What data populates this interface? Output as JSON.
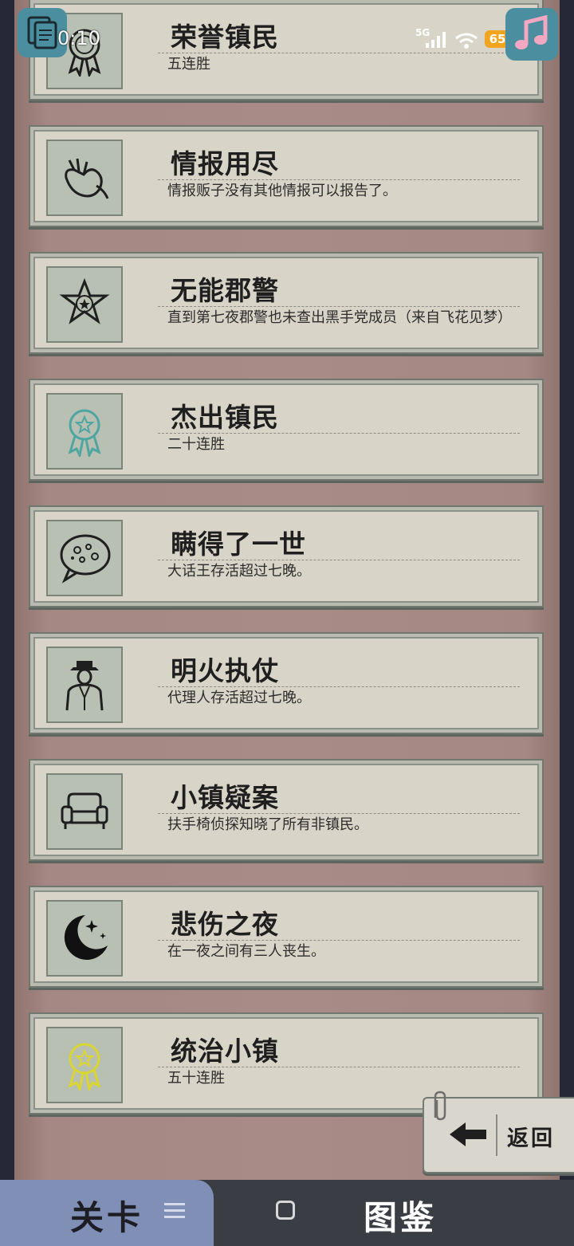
{
  "status_bar": {
    "time": "0:10",
    "network": "5G",
    "battery": "65"
  },
  "achievements": [
    {
      "title": "荣誉镇民",
      "desc": "五连胜",
      "icon": "ribbon-medal-icon"
    },
    {
      "title": "情报用尽",
      "desc": "情报贩子没有其他情报可以报告了。",
      "icon": "hand-gesture-icon"
    },
    {
      "title": "无能郡警",
      "desc": "直到第七夜郡警也未查出黑手党成员（来自飞花见梦）",
      "icon": "sheriff-star-icon"
    },
    {
      "title": "杰出镇民",
      "desc": "二十连胜",
      "icon": "teal-ribbon-medal-icon"
    },
    {
      "title": "瞒得了一世",
      "desc": "大话王存活超过七晚。",
      "icon": "speech-bubble-icon"
    },
    {
      "title": "明火执仗",
      "desc": "代理人存活超过七晚。",
      "icon": "suited-agent-icon"
    },
    {
      "title": "小镇疑案",
      "desc": "扶手椅侦探知晓了所有非镇民。",
      "icon": "armchair-icon"
    },
    {
      "title": "悲伤之夜",
      "desc": "在一夜之间有三人丧生。",
      "icon": "crescent-moon-icon"
    },
    {
      "title": "统治小镇",
      "desc": "五十连胜",
      "icon": "gold-ribbon-medal-icon"
    }
  ],
  "back_button": {
    "label": "返回",
    "icon": "arrow-left-icon"
  },
  "bottom_tabs": {
    "levels": "关卡",
    "gallery": "图鉴"
  },
  "colors": {
    "board": "#a88a86",
    "card": "#d8d5c8",
    "bottom_active": "#7f8fb6",
    "bottom_bg": "#3b3d45"
  }
}
